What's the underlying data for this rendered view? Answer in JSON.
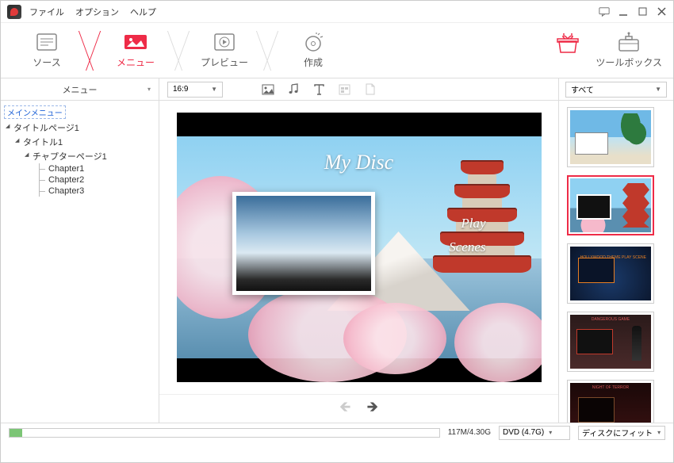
{
  "menubar": {
    "file": "ファイル",
    "option": "オプション",
    "help": "ヘルプ"
  },
  "toolbar": {
    "source": "ソース",
    "menu": "メニュー",
    "preview": "プレビュー",
    "create": "作成",
    "toolbox": "ツールボックス"
  },
  "subbar": {
    "tree_header": "メニュー",
    "aspect": "16:9",
    "filter_all": "すべて"
  },
  "tree": {
    "caption": "メインメニュー",
    "title_page": "タイトルページ1",
    "title": "タイトル1",
    "chapter_page": "チャプターページ1",
    "chapters": [
      "Chapter1",
      "Chapter2",
      "Chapter3"
    ]
  },
  "disc": {
    "title": "My Disc",
    "play": "Play",
    "scenes": "Scenes"
  },
  "templates": {
    "t3_lines": "HOLLYWOOD\nTHEME\nPLAY\nSCENE",
    "t4_title": "DANGEROUS GAME",
    "t5_title": "NIGHT OF TERROR"
  },
  "status": {
    "size": "117M/4.30G",
    "disc_type": "DVD (4.7G)",
    "fit": "ディスクにフィット"
  }
}
